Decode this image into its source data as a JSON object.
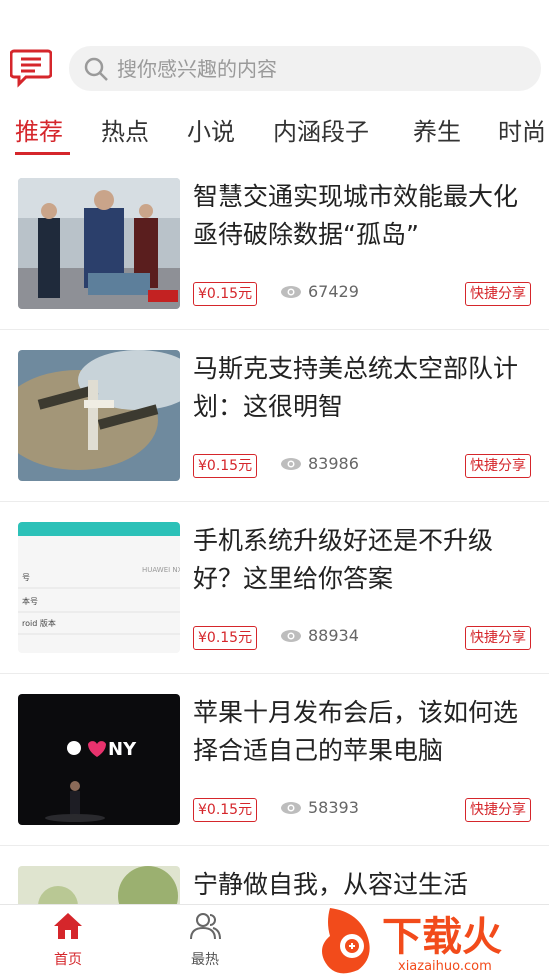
{
  "search": {
    "placeholder": "搜你感兴趣的内容"
  },
  "tabs": [
    {
      "label": "推荐",
      "active": true
    },
    {
      "label": "热点",
      "active": false
    },
    {
      "label": "小说",
      "active": false
    },
    {
      "label": "内涵段子",
      "active": false
    },
    {
      "label": "养生",
      "active": false
    },
    {
      "label": "时尚",
      "active": false
    }
  ],
  "articles": [
    {
      "title": "智慧交通实现城市效能最大化 亟待破除数据“孤岛”",
      "price": "¥0.15元",
      "views": "67429",
      "share": "快捷分享"
    },
    {
      "title": "马斯克支持美总统太空部队计划：这很明智",
      "price": "¥0.15元",
      "views": "83986",
      "share": "快捷分享"
    },
    {
      "title": "手机系统升级好还是不升级好？这里给你答案",
      "price": "¥0.15元",
      "views": "88934",
      "share": "快捷分享"
    },
    {
      "title": "苹果十月发布会后，该如何选择合适自己的苹果电脑",
      "price": "¥0.15元",
      "views": "58393",
      "share": "快捷分享"
    },
    {
      "title": "宁静做自我，从容过生活"
    }
  ],
  "thumb_text": {
    "phone_brand": "HUAWEI NXT-",
    "phone_rows": [
      "号",
      "本号",
      "roid 版本"
    ],
    "ny": "NY"
  },
  "bottom_nav": [
    {
      "label": "首页",
      "active": true
    },
    {
      "label": "最热",
      "active": false
    }
  ],
  "watermark": {
    "brand": "下载火",
    "url": "xiazaihuo.com"
  },
  "colors": {
    "accent": "#d5262b",
    "watermark": "#f24b1b"
  }
}
